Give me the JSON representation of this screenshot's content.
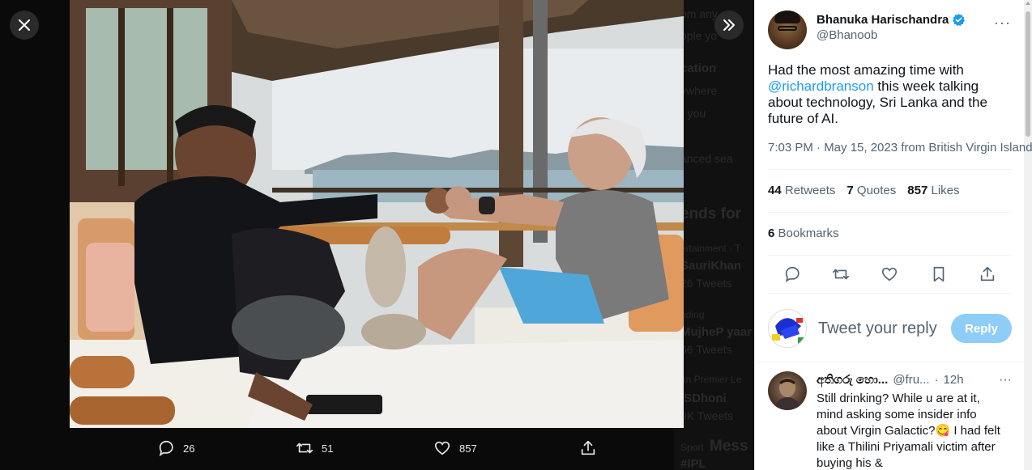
{
  "media_viewer": {
    "close_label": "Close",
    "collapse_label": "Hide details",
    "actions": {
      "replies": "26",
      "retweets": "51",
      "likes": "857"
    }
  },
  "background_page": {
    "ghost_lines": [
      "om any",
      "ople yo",
      "cation",
      "ywhere",
      "r you",
      "anced sea",
      "ends for",
      "ertainment · T",
      "SauriKhan",
      "26 Tweets",
      "nding",
      "MujheP yaar",
      "66 Tweets",
      "an Premier Le",
      "ISDhoni",
      "9K Tweets",
      "Sport",
      "Mess",
      "#IPL"
    ]
  },
  "tweet": {
    "author": {
      "name": "Bhanuka Harischandra",
      "handle": "@Bhanoob",
      "verified": true
    },
    "text_before": "Had the most amazing time with ",
    "mention": "@richardbranson",
    "text_after": " this week talking about technology, Sri Lanka and the future of AI.",
    "timestamp": "7:03 PM · May 15, 2023 from British Virgin Islands",
    "retweets_count": "44",
    "retweets_label": "Retweets",
    "quotes_count": "7",
    "quotes_label": "Quotes",
    "likes_count": "857",
    "likes_label": "Likes",
    "bookmarks_count": "6",
    "bookmarks_label": "Bookmarks"
  },
  "reply_composer": {
    "placeholder": "Tweet your reply",
    "button_label": "Reply"
  },
  "replies": [
    {
      "name": "අතිගරු හො...",
      "handle": "@fru...",
      "time": "12h",
      "text": "Still drinking? While u are at it, mind asking some insider info about Virgin Galactic?😋 I had felt like a Thilini Priyamali victim after buying his &"
    }
  ],
  "colors": {
    "accent": "#1d9bf0",
    "reply_button_disabled": "#8ecdf8",
    "text_secondary": "#536471"
  }
}
